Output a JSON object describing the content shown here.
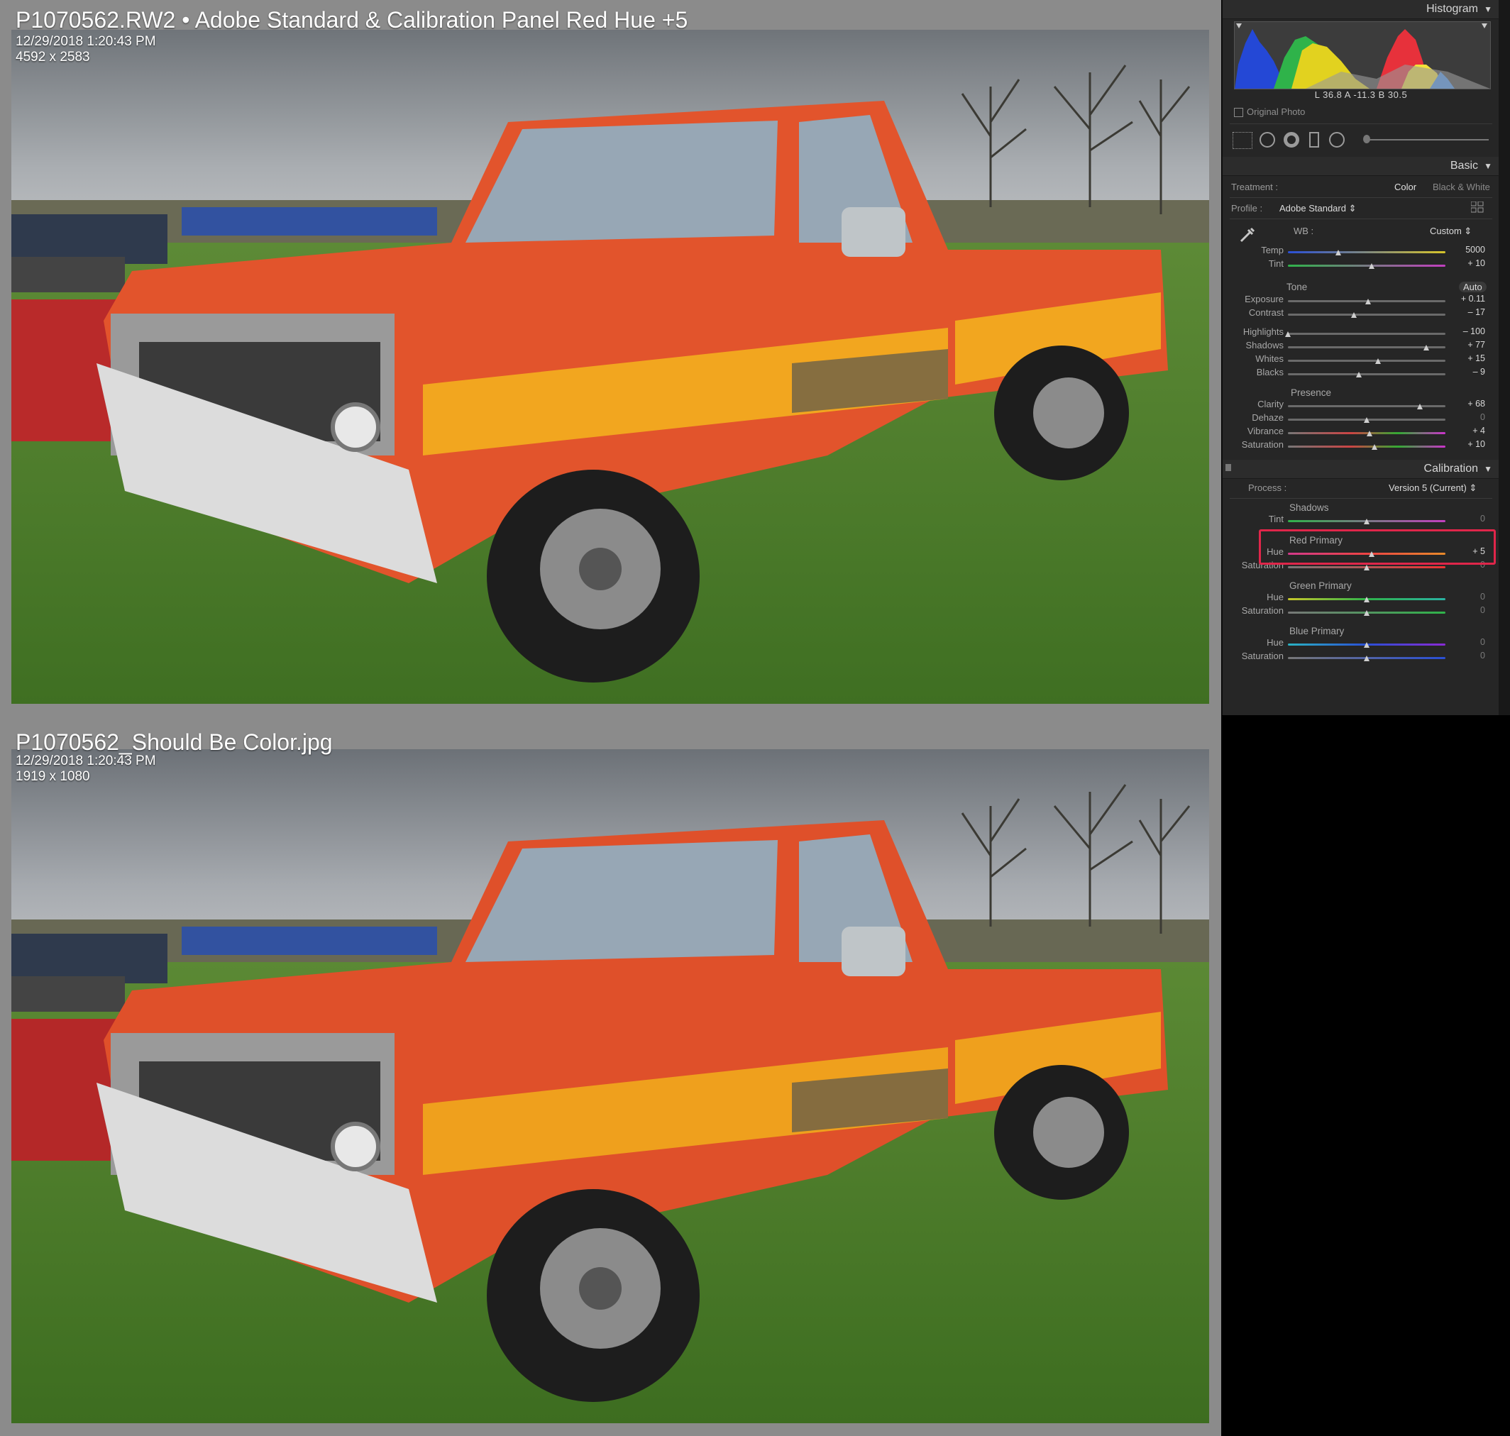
{
  "top_photo": {
    "title": "P1070562.RW2  •  Adobe Standard & Calibration Panel Red Hue +5",
    "date": "12/29/2018 1:20:43 PM",
    "dimensions": "4592 x 2583"
  },
  "bottom_photo": {
    "title": "P1070562_Should Be Color.jpg",
    "date": "12/29/2018 1:20:43 PM",
    "dimensions": "1919 x 1080"
  },
  "histogram": {
    "header": "Histogram",
    "readout": "L  36.8   A  -11.3   B  30.5",
    "original_photo_label": "Original Photo"
  },
  "basic": {
    "header": "Basic",
    "treatment_label": "Treatment :",
    "treatment_color": "Color",
    "treatment_bw": "Black & White",
    "profile_label": "Profile :",
    "profile_value": "Adobe Standard",
    "wb_label": "WB :",
    "wb_value": "Custom",
    "temp": {
      "label": "Temp",
      "value": "5000",
      "level": 0.32
    },
    "tint": {
      "label": "Tint",
      "value": "+ 10",
      "level": 0.53
    },
    "tone_label": "Tone",
    "auto_label": "Auto",
    "exposure": {
      "label": "Exposure",
      "value": "+ 0.11",
      "level": 0.51
    },
    "contrast": {
      "label": "Contrast",
      "value": "– 17",
      "level": 0.42
    },
    "highlights": {
      "label": "Highlights",
      "value": "– 100",
      "level": 0.0
    },
    "shadows": {
      "label": "Shadows",
      "value": "+ 77",
      "level": 0.88
    },
    "whites": {
      "label": "Whites",
      "value": "+ 15",
      "level": 0.57
    },
    "blacks": {
      "label": "Blacks",
      "value": "– 9",
      "level": 0.45
    },
    "presence_label": "Presence",
    "clarity": {
      "label": "Clarity",
      "value": "+ 68",
      "level": 0.84
    },
    "dehaze": {
      "label": "Dehaze",
      "value": "0",
      "level": 0.5
    },
    "vibrance": {
      "label": "Vibrance",
      "value": "+ 4",
      "level": 0.52
    },
    "saturation": {
      "label": "Saturation",
      "value": "+ 10",
      "level": 0.55
    }
  },
  "calibration": {
    "header": "Calibration",
    "process_label": "Process :",
    "process_value": "Version 5 (Current)",
    "shadows_title": "Shadows",
    "shadows_tint": {
      "label": "Tint",
      "value": "0",
      "level": 0.5
    },
    "red_title": "Red Primary",
    "red_hue": {
      "label": "Hue",
      "value": "+ 5",
      "level": 0.53
    },
    "red_sat": {
      "label": "Saturation",
      "value": "0",
      "level": 0.5
    },
    "green_title": "Green Primary",
    "green_hue": {
      "label": "Hue",
      "value": "0",
      "level": 0.5
    },
    "green_sat": {
      "label": "Saturation",
      "value": "0",
      "level": 0.5
    },
    "blue_title": "Blue Primary",
    "blue_hue": {
      "label": "Hue",
      "value": "0",
      "level": 0.5
    },
    "blue_sat": {
      "label": "Saturation",
      "value": "0",
      "level": 0.5
    }
  },
  "colors": {
    "highlight_box": "#e0264a",
    "truck_orange": "#e2542c",
    "stripe_yellow": "#f2a61f"
  }
}
